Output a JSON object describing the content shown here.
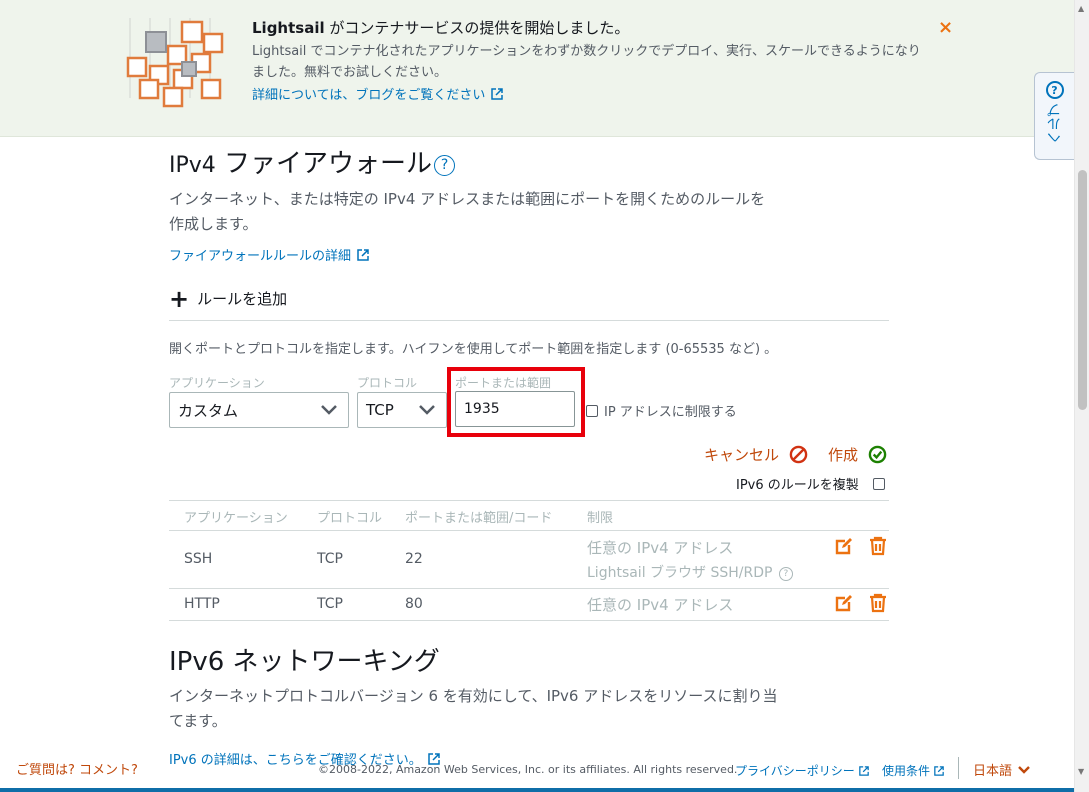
{
  "banner": {
    "title_brand": "Lightsail",
    "title_rest": " がコンテナサービスの提供を開始しました。",
    "description": "Lightsail でコンテナ化されたアプリケーションをわずか数クリックでデプロイ、実行、スケールできるようになりました。無料でお試しください。",
    "link": "詳細については、ブログをご覧ください",
    "close": "×"
  },
  "help_tab": {
    "label": "ヘルプ",
    "icon": "question-circle-icon"
  },
  "ipv4": {
    "title_prefix": "IPv4",
    "title_main": " ファイアウォール",
    "description": "インターネット、または特定の IPv4 アドレスまたは範囲にポートを開くためのルールを作成します。",
    "details_link": "ファイアウォールルールの詳細",
    "add_rule": "ルールを追加",
    "hint": "開くポートとプロトコルを指定します。ハイフンを使用してポート範囲を指定します (0-65535 など) 。",
    "form": {
      "application_label": "アプリケーション",
      "application_value": "カスタム",
      "protocol_label": "プロトコル",
      "protocol_value": "TCP",
      "port_label": "ポートまたは範囲",
      "port_value": "1935",
      "restrict_label": "IP アドレスに制限する"
    },
    "cancel": "キャンセル",
    "create": "作成",
    "duplicate_ipv6": "IPv6 のルールを複製",
    "table": {
      "headers": [
        "アプリケーション",
        "プロトコル",
        "ポートまたは範囲/コード",
        "制限"
      ],
      "rows": [
        {
          "app": "SSH",
          "protocol": "TCP",
          "port": "22",
          "restriction": "任意の IPv4 アドレス",
          "restriction2": "Lightsail ブラウザ SSH/RDP"
        },
        {
          "app": "HTTP",
          "protocol": "TCP",
          "port": "80",
          "restriction": "任意の IPv4 アドレス",
          "restriction2": ""
        }
      ]
    }
  },
  "ipv6": {
    "title_prefix": "IPv6",
    "title_main": " ネットワーキング",
    "description": "インターネットプロトコルバージョン 6 を有効にして、IPv6 アドレスをリソースに割り当てます。",
    "details_link": "IPv6 の詳細は、こちらをご確認ください。"
  },
  "footer": {
    "feedback": "ご質問は? コメント?",
    "copyright": "©2008-2022, Amazon Web Services, Inc. or its affiliates. All rights reserved.",
    "privacy": "プライバシーポリシー",
    "terms": "使用条件",
    "language": "日本語"
  },
  "colors": {
    "accent": "#ec7211",
    "link": "#0073bb",
    "highlight": "#e8000b",
    "success": "#1d8102"
  }
}
